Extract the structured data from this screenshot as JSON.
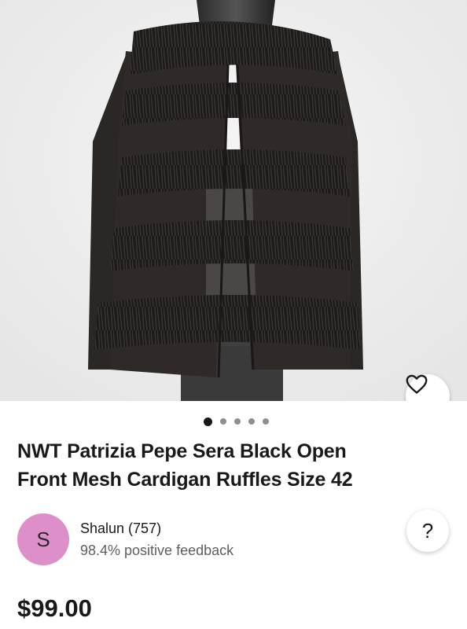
{
  "listing": {
    "title_line1": "NWT Patrizia Pepe Sera Black Open",
    "title_line2": "Front Mesh Cardigan Ruffles Size 42",
    "price": "$99.00",
    "image_count": 5,
    "active_image_index": 0
  },
  "seller": {
    "avatar_letter": "S",
    "name": "Shalun (757)",
    "feedback": "98.4% positive feedback",
    "avatar_color": "#dd8fc9"
  },
  "actions": {
    "favorite_icon": "heart-icon",
    "help_label": "?"
  },
  "colors": {
    "image_background": "#eeeeee",
    "text_primary": "#191919",
    "text_secondary": "#5e5e5e"
  }
}
